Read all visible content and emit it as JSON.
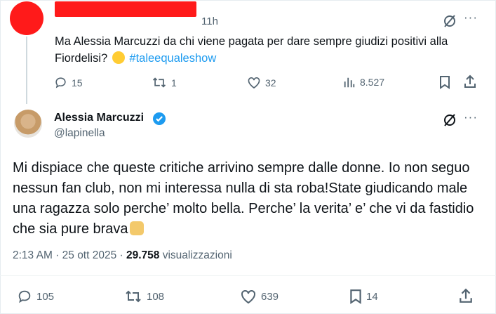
{
  "reply": {
    "time": "11h",
    "text_main": "Ma Alessia Marcuzzi da chi viene pagata per dare sempre giudizi positivi alla Fiordelisi?",
    "hashtag": "#taleequaleshow",
    "emoji_icon": "rofl-emoji-icon",
    "stats": {
      "replies": "15",
      "retweets": "1",
      "likes": "32",
      "views": "8.527"
    },
    "more": "···"
  },
  "tweet": {
    "name": "Alessia Marcuzzi",
    "handle": "@lapinella",
    "verified_color": "#1d9bf0",
    "text": "Mi dispiace che queste critiche arrivino sempre dalle donne. Io non seguo nessun fan club, non mi interessa nulla di sta roba!State giudicando male una ragazza solo perche’ molto bella. Perche’ la verita’ e’ che vi da fastidio che sia pure brava",
    "emoji_icon": "woman-shrugging-emoji-icon",
    "time_date": "2:13 AM · 25 ott 2025 · ",
    "views_count": "29.758",
    "views_label": " visualizzazioni",
    "stats": {
      "replies": "105",
      "retweets": "108",
      "likes": "639",
      "bookmarks": "14"
    },
    "more": "···"
  },
  "colors": {
    "accent": "#1d9bf0",
    "muted": "#536471",
    "redaction": "#ff1a1a"
  }
}
